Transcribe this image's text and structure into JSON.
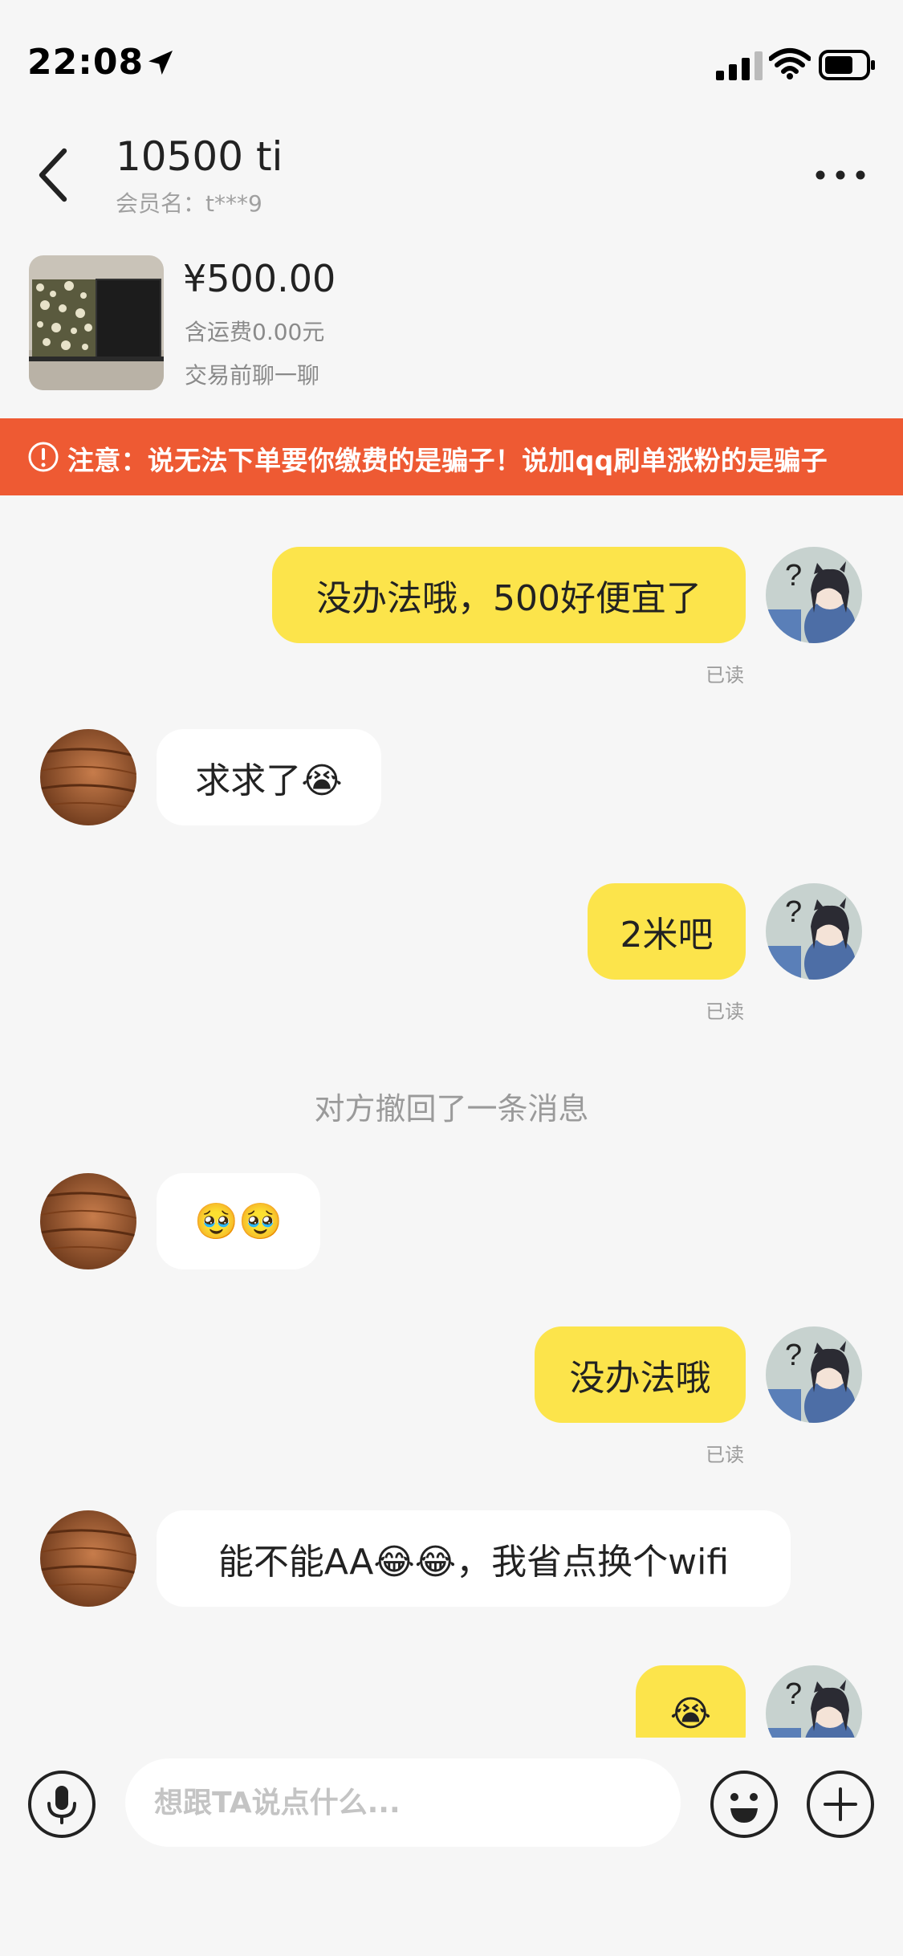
{
  "status_bar": {
    "time": "22:08",
    "icons": [
      "location-arrow-icon",
      "signal-icon",
      "wifi-icon",
      "battery-icon"
    ]
  },
  "header": {
    "peer_name": "10500 ti",
    "member_label": "会员名：t***9",
    "icons": [
      "back-icon",
      "more-icon"
    ]
  },
  "product": {
    "price": "¥500.00",
    "shipping": "含运费0.00元",
    "hint": "交易前聊一聊"
  },
  "warning": {
    "text": "注意：说无法下单要你缴费的是骗子！说加qq刷单涨粉的是骗子",
    "color": "#ee5a33"
  },
  "messages": [
    {
      "sender": "me",
      "text": "没办法哦，500好便宜了",
      "status": "已读"
    },
    {
      "sender": "them",
      "text": "求求了😭"
    },
    {
      "sender": "me",
      "text": "2米吧",
      "status": "已读"
    },
    {
      "sender": "system",
      "text": "对方撤回了一条消息"
    },
    {
      "sender": "them",
      "text": "🥹🥹"
    },
    {
      "sender": "me",
      "text": "没办法哦",
      "status": "已读"
    },
    {
      "sender": "them",
      "text": "能不能AA😂😂，我省点换个wifi"
    },
    {
      "sender": "me",
      "text": "😭"
    }
  ],
  "input": {
    "placeholder": "想跟TA说点什么...",
    "icons": [
      "microphone-icon",
      "emoji-icon",
      "plus-icon"
    ]
  },
  "colors": {
    "my_bubble": "#fce44b",
    "their_bubble": "#ffffff",
    "background": "#f6f6f6"
  }
}
